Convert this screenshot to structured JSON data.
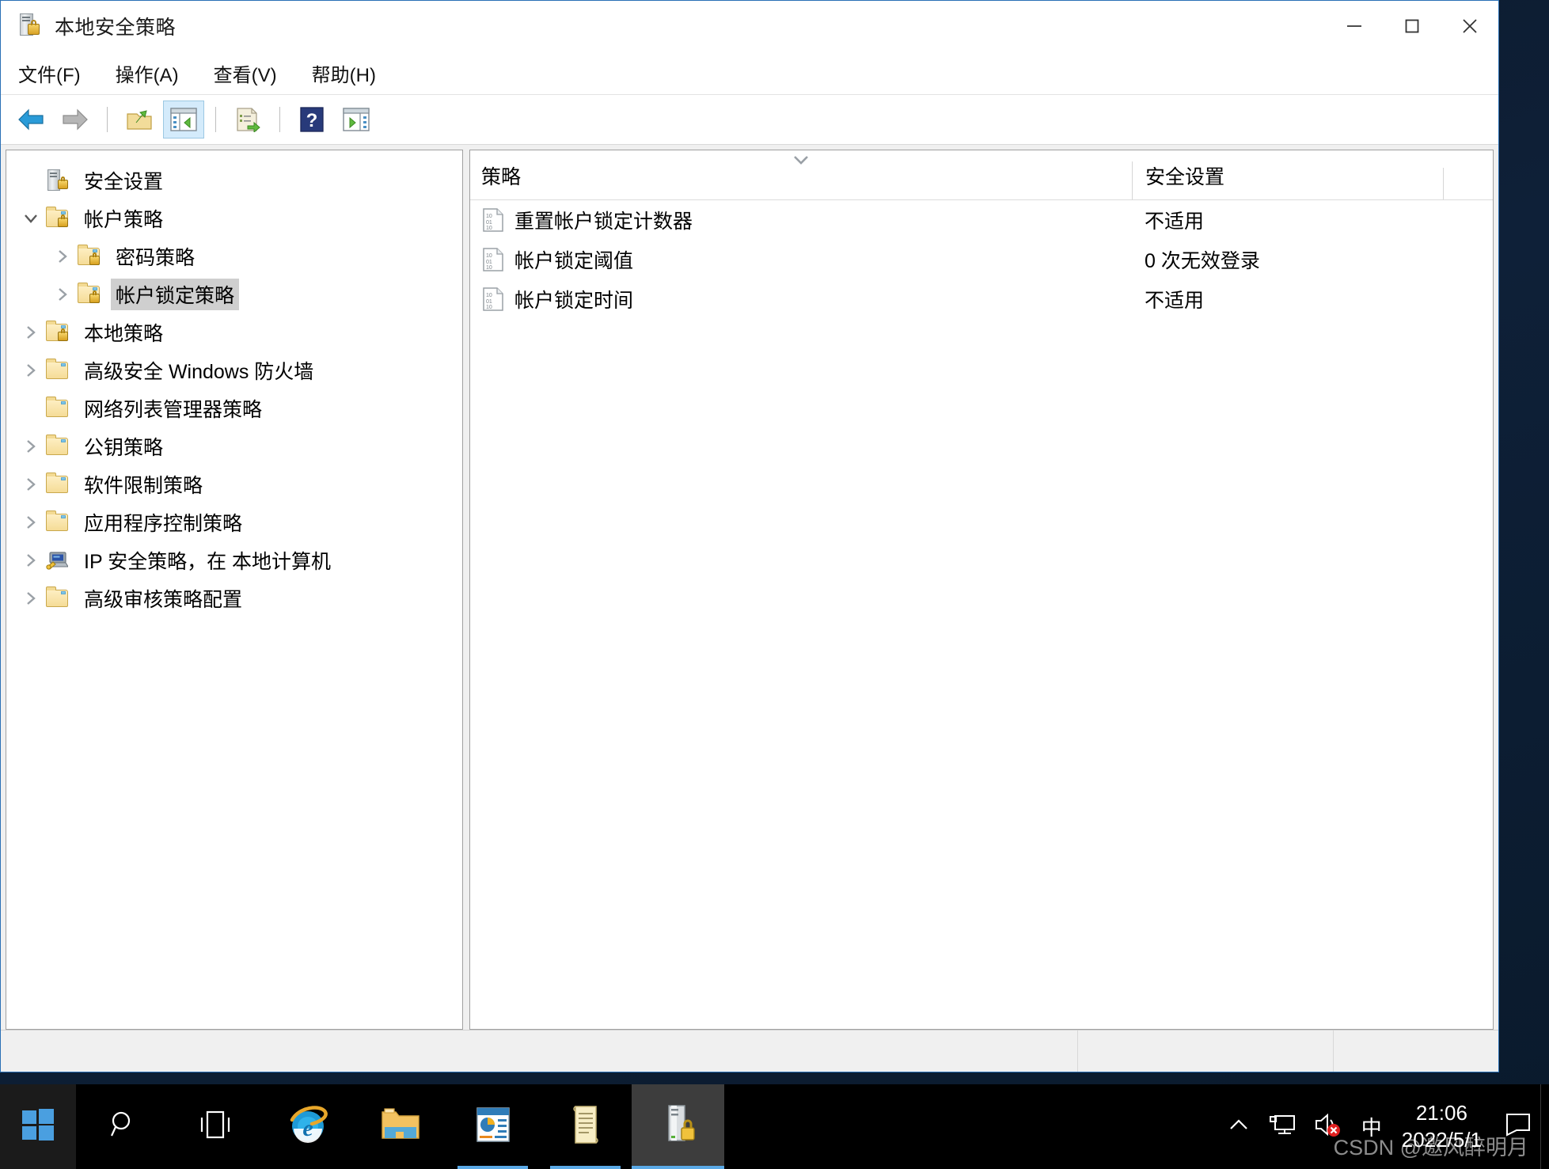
{
  "window": {
    "title": "本地安全策略",
    "title_icon": "server-lock-icon",
    "controls": {
      "minimize": "最小化",
      "maximize": "最大化",
      "close": "关闭"
    }
  },
  "menubar": [
    {
      "label": "文件(F)",
      "name": "menu-file"
    },
    {
      "label": "操作(A)",
      "name": "menu-action"
    },
    {
      "label": "查看(V)",
      "name": "menu-view"
    },
    {
      "label": "帮助(H)",
      "name": "menu-help"
    }
  ],
  "toolbar": [
    {
      "name": "back-button",
      "icon": "back-arrow-icon",
      "active": false
    },
    {
      "name": "forward-button",
      "icon": "forward-arrow-icon",
      "active": false
    },
    {
      "name": "up-one-level-button",
      "icon": "folder-up-icon",
      "active": false
    },
    {
      "name": "show-hide-tree-button",
      "icon": "console-tree-icon",
      "active": true
    },
    {
      "name": "export-list-button",
      "icon": "export-list-icon",
      "active": false
    },
    {
      "name": "help-button",
      "icon": "help-question-icon",
      "active": false
    },
    {
      "name": "show-action-pane-button",
      "icon": "action-pane-icon",
      "active": false
    }
  ],
  "tree": [
    {
      "label": "安全设置",
      "depth": 0,
      "icon": "server-lock-icon",
      "expander": "none",
      "selected": false
    },
    {
      "label": "帐户策略",
      "depth": 0,
      "icon": "folder-lock-icon",
      "expander": "expanded",
      "selected": false
    },
    {
      "label": "密码策略",
      "depth": 1,
      "icon": "folder-lock-icon",
      "expander": "collapsed",
      "selected": false
    },
    {
      "label": "帐户锁定策略",
      "depth": 1,
      "icon": "folder-lock-icon",
      "expander": "collapsed",
      "selected": true
    },
    {
      "label": "本地策略",
      "depth": 0,
      "icon": "folder-lock-icon",
      "expander": "collapsed",
      "selected": false
    },
    {
      "label": "高级安全 Windows 防火墙",
      "depth": 0,
      "icon": "folder-icon",
      "expander": "collapsed",
      "selected": false
    },
    {
      "label": "网络列表管理器策略",
      "depth": 0,
      "icon": "folder-icon",
      "expander": "none",
      "selected": false
    },
    {
      "label": "公钥策略",
      "depth": 0,
      "icon": "folder-icon",
      "expander": "collapsed",
      "selected": false
    },
    {
      "label": "软件限制策略",
      "depth": 0,
      "icon": "folder-icon",
      "expander": "collapsed",
      "selected": false
    },
    {
      "label": "应用程序控制策略",
      "depth": 0,
      "icon": "folder-icon",
      "expander": "collapsed",
      "selected": false
    },
    {
      "label": "IP 安全策略，在 本地计算机",
      "depth": 0,
      "icon": "ip-security-icon",
      "expander": "collapsed",
      "selected": false
    },
    {
      "label": "高级审核策略配置",
      "depth": 0,
      "icon": "folder-icon",
      "expander": "collapsed",
      "selected": false
    }
  ],
  "list": {
    "columns": {
      "policy": "策略",
      "setting": "安全设置"
    },
    "rows": [
      {
        "policy": "重置帐户锁定计数器",
        "setting": "不适用",
        "icon": "policy-doc-icon"
      },
      {
        "policy": "帐户锁定阈值",
        "setting": "0 次无效登录",
        "icon": "policy-doc-icon"
      },
      {
        "policy": "帐户锁定时间",
        "setting": "不适用",
        "icon": "policy-doc-icon"
      }
    ]
  },
  "statusbar": {
    "message": "",
    "pane1": "",
    "pane2": ""
  },
  "taskbar": {
    "start": {
      "name": "start-button",
      "icon": "windows-logo-icon"
    },
    "items": [
      {
        "name": "taskbar-search",
        "icon": "search-icon",
        "state": "idle"
      },
      {
        "name": "taskbar-task-view",
        "icon": "task-view-icon",
        "state": "idle"
      },
      {
        "name": "taskbar-internet-explorer",
        "icon": "internet-explorer-icon",
        "state": "idle"
      },
      {
        "name": "taskbar-file-explorer",
        "icon": "file-explorer-icon",
        "state": "idle"
      },
      {
        "name": "taskbar-powerpoint",
        "icon": "powerpoint-icon",
        "state": "running"
      },
      {
        "name": "taskbar-notepad",
        "icon": "notepad-scroll-icon",
        "state": "running"
      },
      {
        "name": "taskbar-local-security-policy",
        "icon": "server-lock-icon",
        "state": "active"
      }
    ],
    "tray": [
      {
        "name": "tray-show-hidden-icons",
        "icon": "chevron-up-icon"
      },
      {
        "name": "tray-network",
        "icon": "network-monitor-icon"
      },
      {
        "name": "tray-volume-muted",
        "icon": "speaker-muted-icon"
      },
      {
        "name": "tray-ime",
        "icon": "ime-icon",
        "label": "中"
      }
    ],
    "clock": {
      "time": "21:06",
      "date": "2022/5/1"
    },
    "watermark": "CSDN @邀风醉明月"
  }
}
